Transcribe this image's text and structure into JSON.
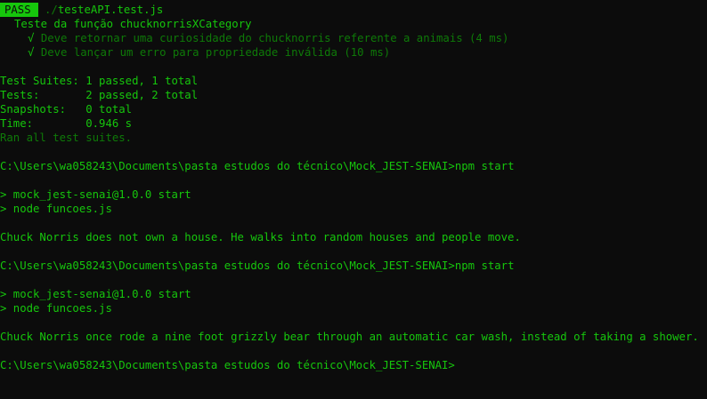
{
  "test_run": {
    "status_badge": "PASS",
    "file_dir": "./",
    "file_name": "testeAPI.test.js",
    "suite_name": "Teste da função chucknorrisXCategory",
    "tests": [
      {
        "mark": "√",
        "label": "Deve retornar uma curiosidade do chucknorris referente a animais (4 ms)"
      },
      {
        "mark": "√",
        "label": "Deve lançar um erro para propriedade inválida (10 ms)"
      }
    ]
  },
  "summary": {
    "suites_label": "Test Suites: ",
    "suites_value": "1 passed, 1 total",
    "tests_label": "Tests:       ",
    "tests_value": "2 passed, 2 total",
    "snapshots_label": "Snapshots:   ",
    "snapshots_value": "0 total",
    "time_label": "Time:        ",
    "time_value": "0.946 s",
    "ran_all": "Ran all test suites."
  },
  "runs": [
    {
      "prompt": "C:\\Users\\wa058243\\Documents\\pasta estudos do técnico\\Mock_JEST-SENAI>",
      "command": "npm start",
      "script_line": "> mock_jest-senai@1.0.0 start",
      "node_line": "> node funcoes.js",
      "output": "Chuck Norris does not own a house. He walks into random houses and people move."
    },
    {
      "prompt": "C:\\Users\\wa058243\\Documents\\pasta estudos do técnico\\Mock_JEST-SENAI>",
      "command": "npm start",
      "script_line": "> mock_jest-senai@1.0.0 start",
      "node_line": "> node funcoes.js",
      "output": "Chuck Norris once rode a nine foot grizzly bear through an automatic car wash, instead of taking a shower."
    }
  ],
  "final_prompt": "C:\\Users\\wa058243\\Documents\\pasta estudos do técnico\\Mock_JEST-SENAI>",
  "colors": {
    "background": "#0c0c0c",
    "text": "#16c60c",
    "dim_text": "#0e7a08",
    "badge_bg": "#16c60c"
  }
}
